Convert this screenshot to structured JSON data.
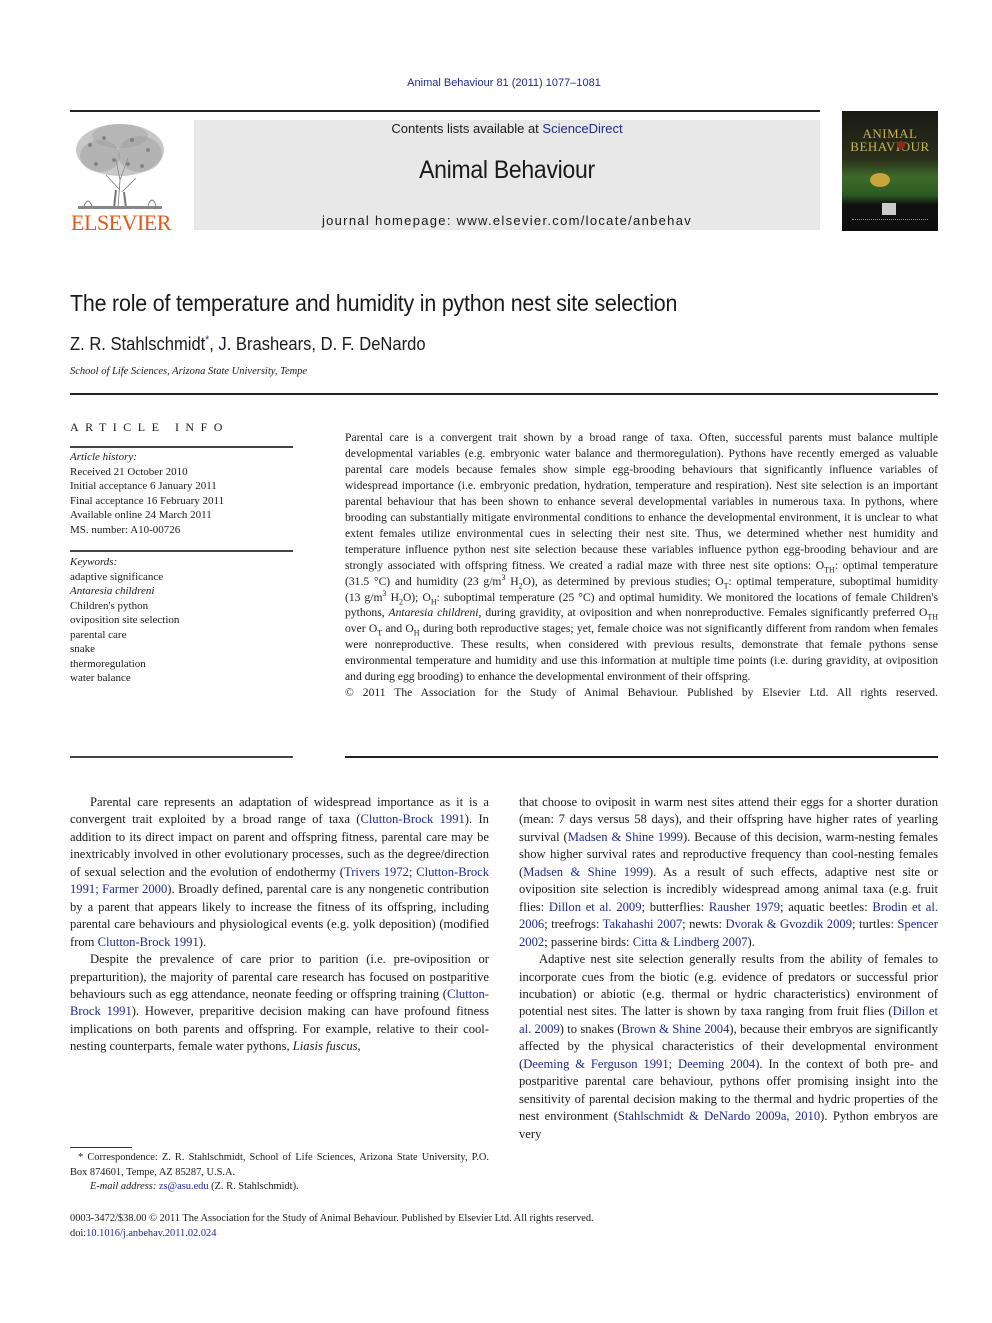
{
  "running_head": "Animal Behaviour 81 (2011) 1077–1081",
  "masthead": {
    "publisher_word": "ELSEVIER",
    "contents_prefix": "Contents lists available at ",
    "contents_link": "ScienceDirect",
    "journal_name": "Animal Behaviour",
    "homepage_line": "journal homepage: www.elsevier.com/locate/anbehav",
    "cover_title_line1": "ANIMAL",
    "cover_title_line2": "BEHAVIOUR"
  },
  "article": {
    "title": "The role of temperature and humidity in python nest site selection",
    "authors": [
      {
        "name": "Z. R. Stahlschmidt",
        "mark": "*"
      },
      {
        "name": "J. Brashears",
        "mark": ""
      },
      {
        "name": "D. F. DeNardo",
        "mark": ""
      }
    ],
    "author_sep": ", ",
    "affiliation": "School of Life Sciences, Arizona State University, Tempe"
  },
  "article_info": {
    "heading": "ARTICLE INFO",
    "history_heading": "Article history:",
    "history": [
      "Received 21 October 2010",
      "Initial acceptance 6 January 2011",
      "Final acceptance 16 February 2011",
      "Available online 24 March 2011",
      "MS. number: A10-00726"
    ],
    "keywords_heading": "Keywords:",
    "keywords": [
      {
        "text": "adaptive significance",
        "italic": false
      },
      {
        "text": "Antaresia childreni",
        "italic": true
      },
      {
        "text": "Children's python",
        "italic": false
      },
      {
        "text": "oviposition site selection",
        "italic": false
      },
      {
        "text": "parental care",
        "italic": false
      },
      {
        "text": "snake",
        "italic": false
      },
      {
        "text": "thermoregulation",
        "italic": false
      },
      {
        "text": "water balance",
        "italic": false
      }
    ]
  },
  "abstract": {
    "p1": "Parental care is a convergent trait shown by a broad range of taxa. Often, successful parents must balance multiple developmental variables (e.g. embryonic water balance and thermoregulation). Pythons have recently emerged as valuable parental care models because females show simple egg-brooding behaviours that significantly influence variables of widespread importance (i.e. embryonic predation, hydration, temperature and respiration). Nest site selection is an important parental behaviour that has been shown to enhance several developmental variables in numerous taxa. In pythons, where brooding can substantially mitigate environmental conditions to enhance the developmental environment, it is unclear to what extent females utilize environmental cues in selecting their nest site. Thus, we determined whether nest humidity and temperature influence python nest site selection because these variables influence python egg-brooding behaviour and are strongly associated with offspring fitness. We created a radial maze with three nest site options: ",
    "o": "O",
    "sub_th": "TH",
    "sub_t": "T",
    "sub_h": "H",
    "p2": ": optimal temperature (31.5 °C) and humidity (23 g/m",
    "sup3": "3",
    "h2o_a": " H",
    "sub2": "2",
    "h2o_b": "O), as determined by previous studies; ",
    "p3": ": optimal temperature, suboptimal humidity (13 g/m",
    "p4": "O); ",
    "p5": ": suboptimal temperature (25 °C) and optimal humidity. We monitored the locations of female Children's pythons, ",
    "species": "Antaresia childreni",
    "p6": ", during gravidity, at oviposition and when nonreproductive. Females significantly preferred ",
    "p7": " over ",
    "p8": " and ",
    "p9": " during both reproductive stages; yet, female choice was not significantly different from random when females were nonreproductive. These results, when considered with previous results, demonstrate that female pythons sense environmental temperature and humidity and use this information at multiple time points (i.e. during gravidity, at oviposition and during egg brooding) to enhance the developmental environment of their offspring.",
    "copyright": "© 2011 The Association for the Study of Animal Behaviour. Published by Elsevier Ltd. All rights reserved."
  },
  "body": {
    "left": {
      "para1": [
        {
          "t": "Parental care represents an adaptation of widespread importance as it is a convergent trait exploited by a broad range of taxa ("
        },
        {
          "t": "Clutton-Brock 1991",
          "link": true
        },
        {
          "t": "). In addition to its direct impact on parent and offspring fitness, parental care may be inextricably involved in other evolutionary processes, such as the degree/direction of sexual selection and the evolution of endothermy ("
        },
        {
          "t": "Trivers 1972; Clutton-Brock 1991; Farmer 2000",
          "link": true
        },
        {
          "t": "). Broadly defined, parental care is any nongenetic contribution by a parent that appears likely to increase the fitness of its offspring, including parental care behaviours and physiological events (e.g. yolk deposition) (modified from "
        },
        {
          "t": "Clutton-Brock 1991",
          "link": true
        },
        {
          "t": ")."
        }
      ],
      "para2": [
        {
          "t": "Despite the prevalence of care prior to parition (i.e. pre-oviposition or preparturition), the majority of parental care research has focused on postparitive behaviours such as egg attendance, neonate feeding or offspring training ("
        },
        {
          "t": "Clutton-Brock 1991",
          "link": true
        },
        {
          "t": "). However, preparitive decision making can have profound fitness implications on both parents and offspring. For example, relative to their cool-nesting counterparts, female water pythons, "
        },
        {
          "t": "Liasis fuscus",
          "italic": true
        },
        {
          "t": ","
        }
      ]
    },
    "right": {
      "para1": [
        {
          "t": "that choose to oviposit in warm nest sites attend their eggs for a shorter duration (mean: 7 days versus 58 days), and their offspring have higher rates of yearling survival ("
        },
        {
          "t": "Madsen & Shine 1999",
          "link": true
        },
        {
          "t": "). Because of this decision, warm-nesting females show higher survival rates and reproductive frequency than cool-nesting females ("
        },
        {
          "t": "Madsen & Shine 1999",
          "link": true
        },
        {
          "t": "). As a result of such effects, adaptive nest site or oviposition site selection is incredibly widespread among animal taxa (e.g. fruit flies: "
        },
        {
          "t": "Dillon et al. 2009",
          "link": true
        },
        {
          "t": "; butterflies: "
        },
        {
          "t": "Rausher 1979",
          "link": true
        },
        {
          "t": "; aquatic beetles: "
        },
        {
          "t": "Brodin et al. 2006",
          "link": true
        },
        {
          "t": "; treefrogs: "
        },
        {
          "t": "Takahashi 2007",
          "link": true
        },
        {
          "t": "; newts: "
        },
        {
          "t": "Dvorak & Gvozdik 2009",
          "link": true
        },
        {
          "t": "; turtles: "
        },
        {
          "t": "Spencer 2002",
          "link": true
        },
        {
          "t": "; passerine birds: "
        },
        {
          "t": "Citta & Lindberg 2007",
          "link": true
        },
        {
          "t": ")."
        }
      ],
      "para2": [
        {
          "t": "Adaptive nest site selection generally results from the ability of females to incorporate cues from the biotic (e.g. evidence of predators or successful prior incubation) or abiotic (e.g. thermal or hydric characteristics) environment of potential nest sites. The latter is shown by taxa ranging from fruit flies ("
        },
        {
          "t": "Dillon et al. 2009",
          "link": true
        },
        {
          "t": ") to snakes ("
        },
        {
          "t": "Brown & Shine 2004",
          "link": true
        },
        {
          "t": "), because their embryos are significantly affected by the physical characteristics of their developmental environment ("
        },
        {
          "t": "Deeming & Ferguson 1991; Deeming 2004",
          "link": true
        },
        {
          "t": "). In the context of both pre- and postparitive parental care behaviour, pythons offer promising insight into the sensitivity of parental decision making to the thermal and hydric properties of the nest environment ("
        },
        {
          "t": "Stahlschmidt & DeNardo 2009a, 2010",
          "link": true
        },
        {
          "t": "). Python embryos are very"
        }
      ]
    }
  },
  "footnote": {
    "mark": "*",
    "correspondence": " Correspondence: Z. R. Stahlschmidt, School of Life Sciences, Arizona State University, P.O. Box 874601, Tempe, AZ 85287, U.S.A.",
    "email_label": "E-mail address: ",
    "email": "zs@asu.edu",
    "email_suffix": " (Z. R. Stahlschmidt)."
  },
  "issn_line": "0003-3472/$38.00 © 2011 The Association for the Study of Animal Behaviour. Published by Elsevier Ltd. All rights reserved.",
  "doi_label": "doi:",
  "doi": "10.1016/j.anbehav.2011.02.024",
  "colors": {
    "link": "#1f2a8a",
    "elsevier_orange": "#e05a1a",
    "banner_gray": "#e8e8e8"
  }
}
